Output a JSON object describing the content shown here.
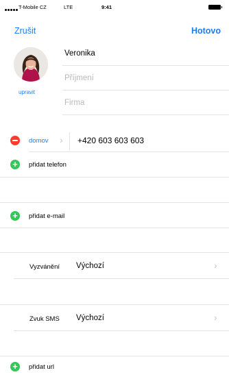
{
  "status_bar": {
    "carrier": "T-Mobile CZ",
    "network": "LTE",
    "time": "9:41"
  },
  "nav": {
    "cancel": "Zrušit",
    "done": "Hotovo"
  },
  "avatar": {
    "edit_label": "upravit"
  },
  "fields": {
    "first_name": "Veronika",
    "last_name_placeholder": "Příjmení",
    "company_placeholder": "Firma"
  },
  "phone": {
    "label": "domov",
    "number": "+420 603 603 603"
  },
  "actions": {
    "add_phone": "přidat telefon",
    "add_email": "přidat e-mail",
    "add_url": "přidat url"
  },
  "ringtone": {
    "label": "Vyzvánění",
    "value": "Výchozí"
  },
  "sms_tone": {
    "label": "Zvuk SMS",
    "value": "Výchozí"
  },
  "colors": {
    "accent": "#1d7cf2",
    "add": "#35c759",
    "remove": "#ff3b30"
  },
  "icons": [
    "signal-dots-icon",
    "battery-icon",
    "add-circle-icon",
    "remove-circle-icon",
    "chevron-right-icon"
  ]
}
